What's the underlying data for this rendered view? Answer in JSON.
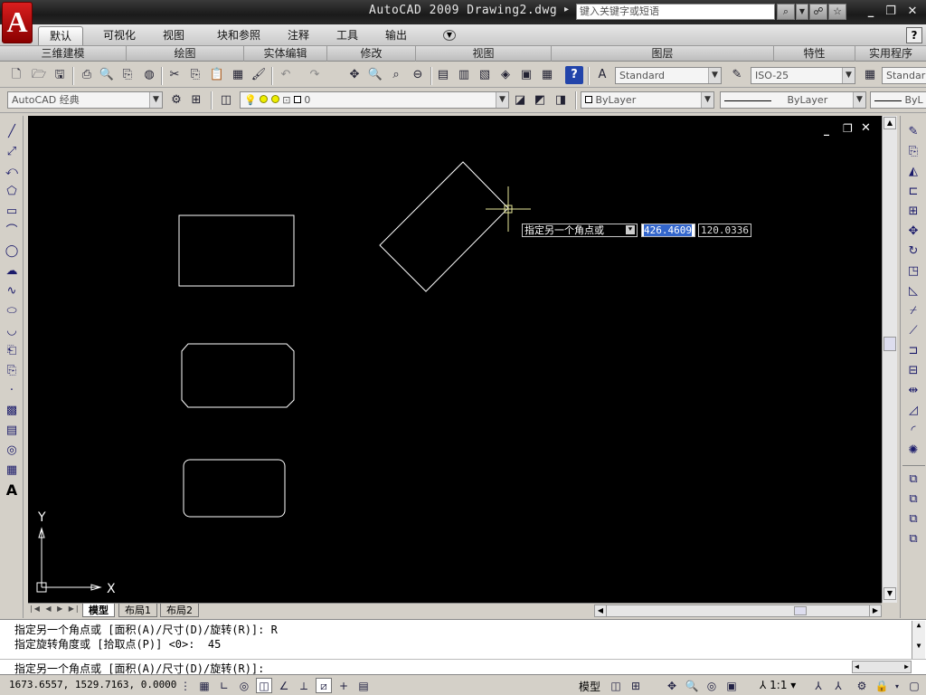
{
  "window": {
    "title": "AutoCAD 2009  Drawing2.dwg",
    "search_placeholder": "键入关键字或短语",
    "logo": "A"
  },
  "ribbon": {
    "tabs": [
      "默认",
      "可视化",
      "视图",
      "块和参照",
      "注释",
      "工具",
      "输出"
    ],
    "panels": [
      "三维建模",
      "绘图",
      "实体编辑",
      "修改",
      "视图",
      "图层",
      "特性",
      "实用程序"
    ]
  },
  "toolbar1": {
    "text_style": "Standard",
    "dim_style": "ISO-25",
    "table_style": "Standar"
  },
  "toolbar2": {
    "workspace": "AutoCAD 经典",
    "layer": "0",
    "color": "ByLayer",
    "linetype": "ByLayer",
    "lineweight": "ByL"
  },
  "canvas": {
    "background": "#000000",
    "dyn_prompt": "指定另一个角点或",
    "dyn_x": "426.4609",
    "dyn_y": "120.0336",
    "ucs_x": "X",
    "ucs_y": "Y"
  },
  "layout_tabs": [
    "模型",
    "布局1",
    "布局2"
  ],
  "command": {
    "line1": "指定另一个角点或 [面积(A)/尺寸(D)/旋转(R)]: R",
    "line2": "指定旋转角度或 [拾取点(P)] <0>:  45",
    "current": "指定另一个角点或 [面积(A)/尺寸(D)/旋转(R)]:"
  },
  "status": {
    "coords": "1673.6557, 1529.7163, 0.0000",
    "model": "模型",
    "scale": "1:1"
  }
}
